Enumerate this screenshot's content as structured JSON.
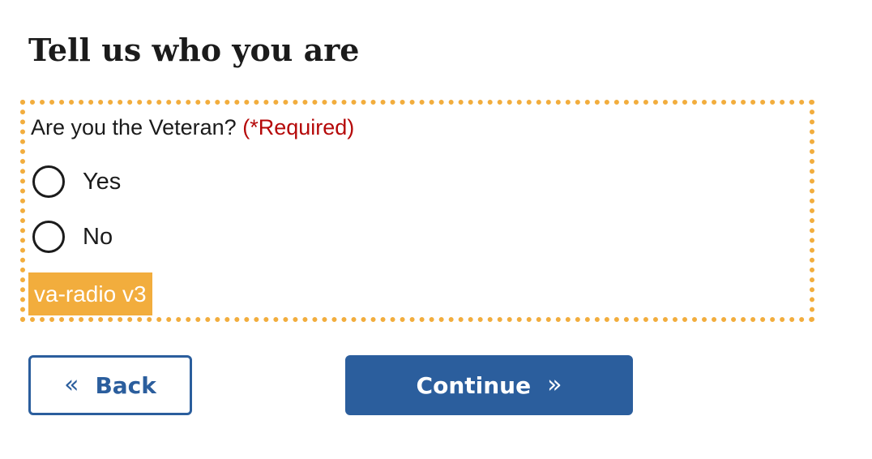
{
  "heading": "Tell us who you are",
  "question": {
    "label": "Are you the Veteran?",
    "required_text": "(*Required)",
    "options": [
      {
        "label": "Yes",
        "selected": false
      },
      {
        "label": "No",
        "selected": false
      }
    ],
    "component_tag": "va-radio v3"
  },
  "navigation": {
    "back_label": "Back",
    "back_icon": "«",
    "continue_label": "Continue",
    "continue_icon": "»"
  },
  "colors": {
    "primary": "#2b5e9d",
    "required": "#b50909",
    "highlight": "#f2ad3d",
    "text": "#1b1b1b"
  }
}
